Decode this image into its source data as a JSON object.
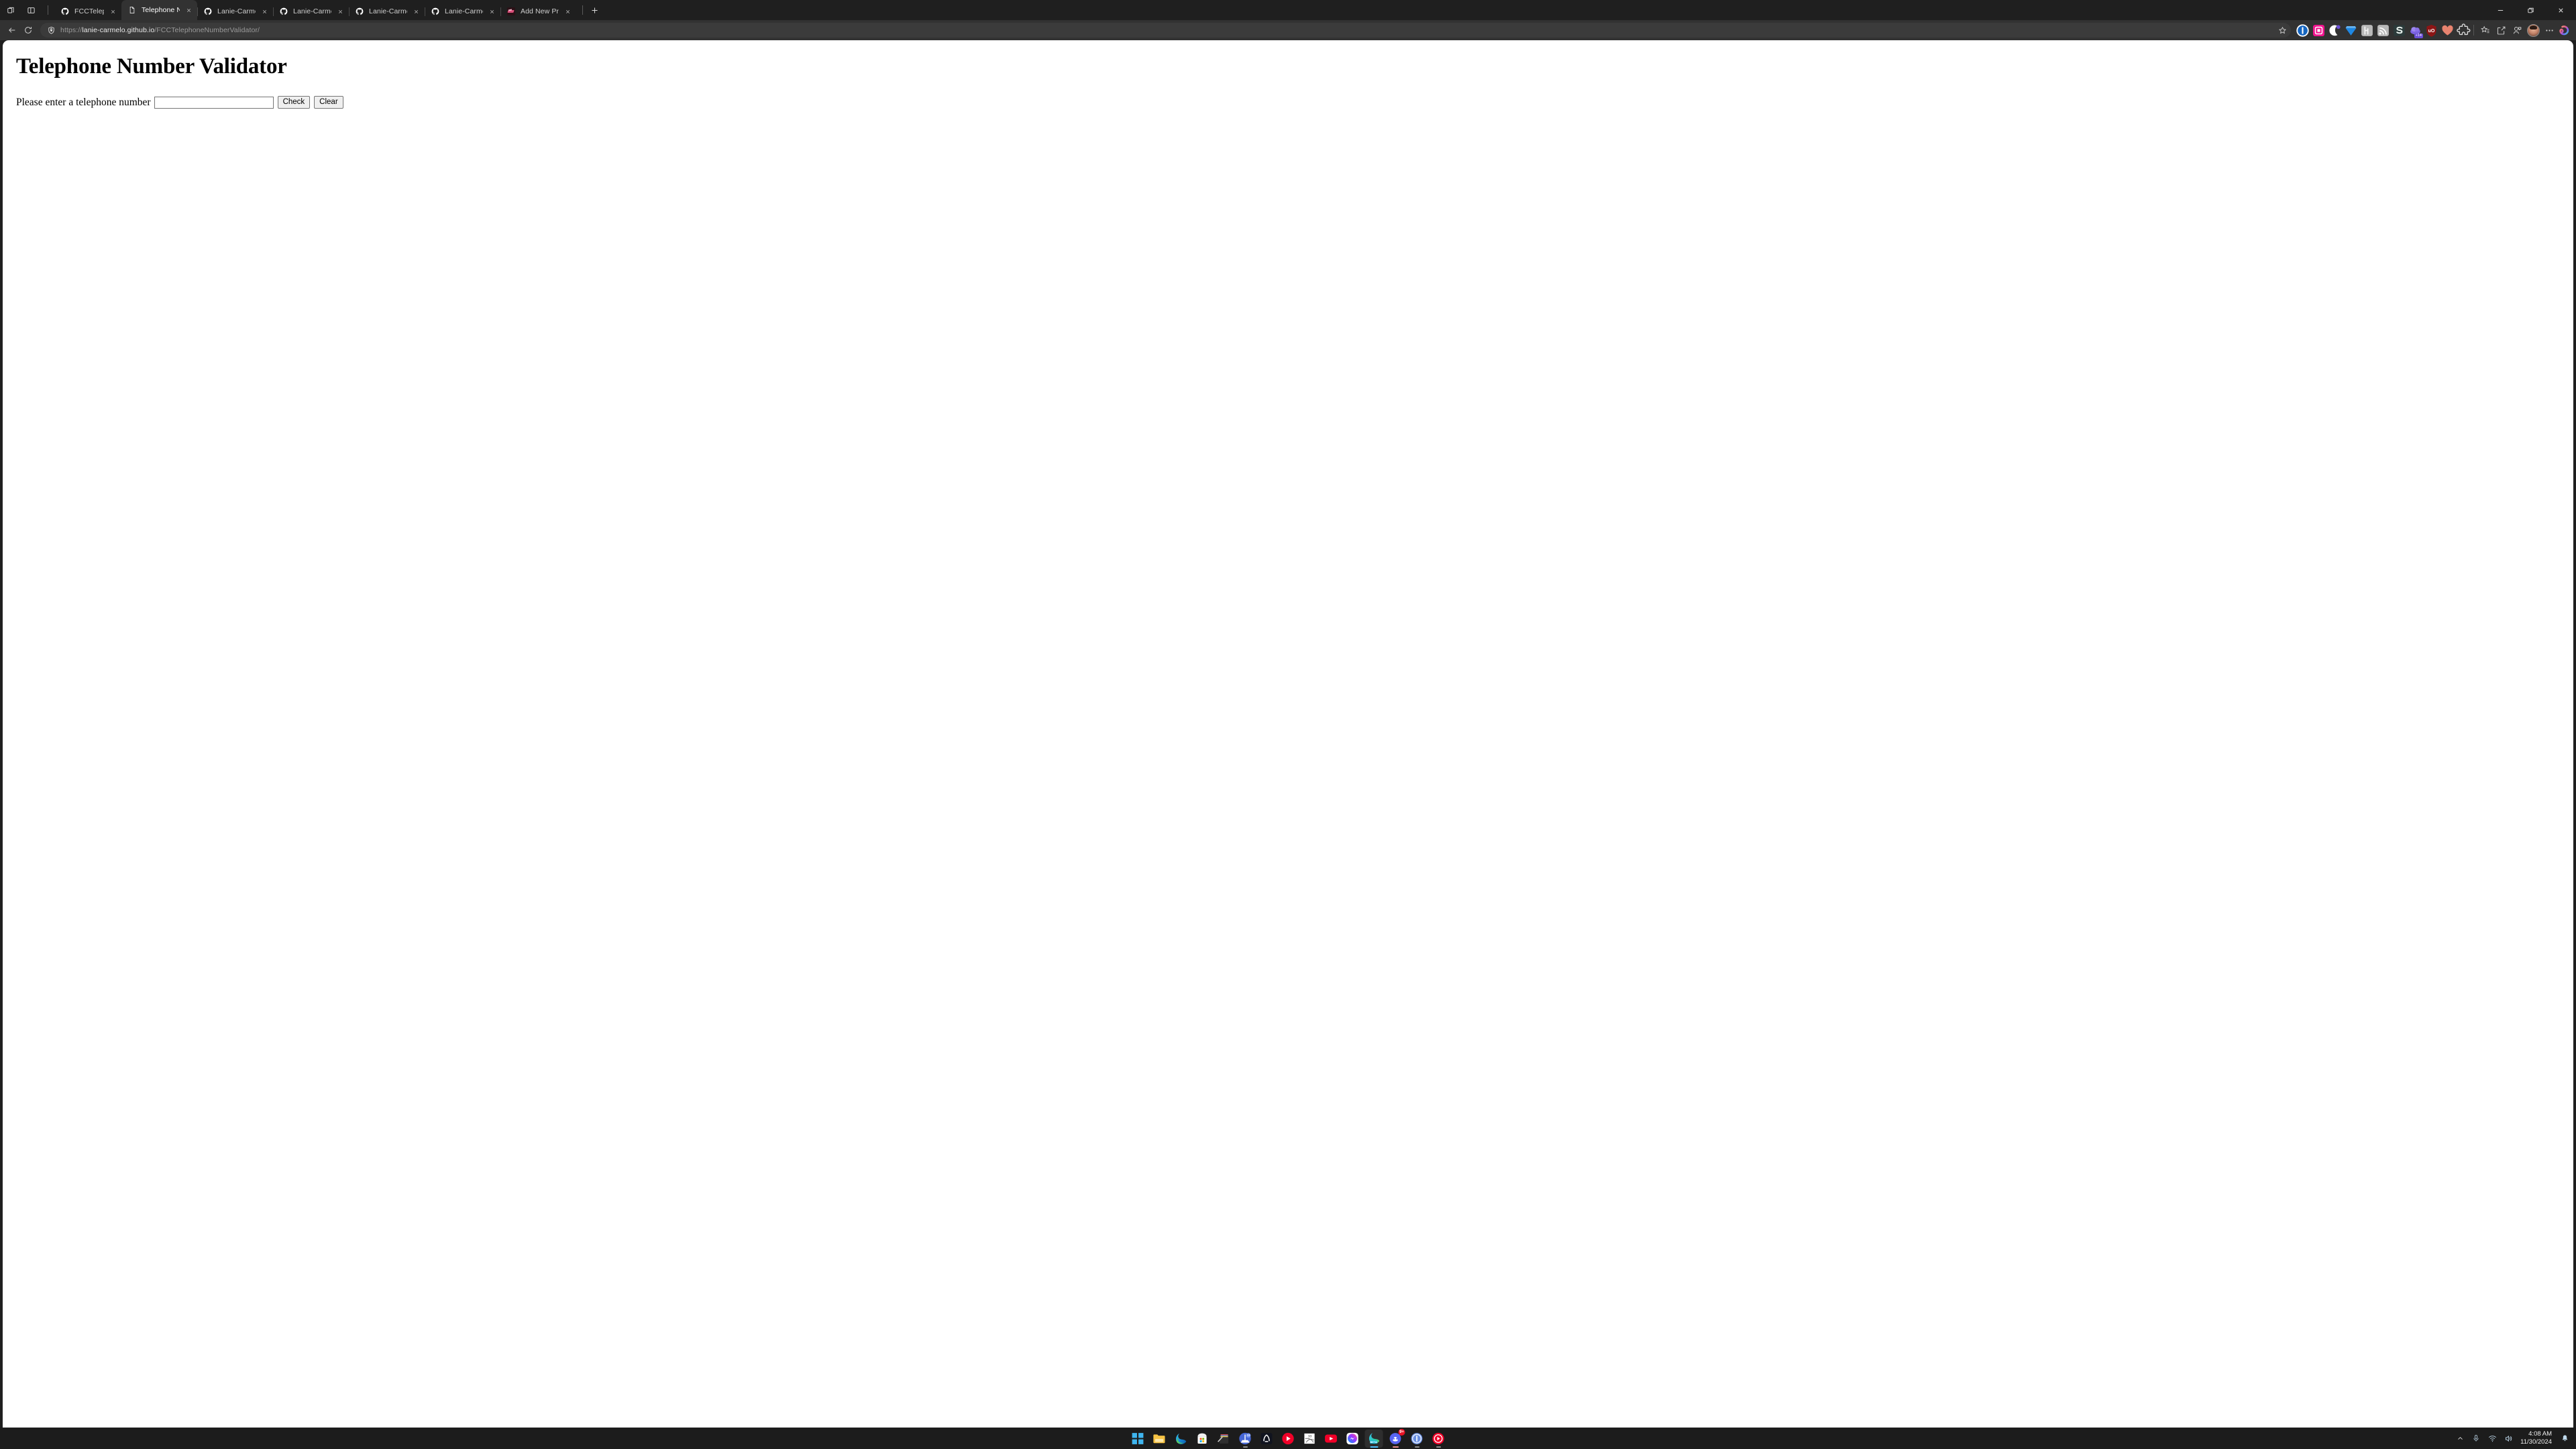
{
  "window": {
    "controls": {
      "minimize_label": "Minimize",
      "maximize_label": "Restore",
      "close_label": "Close"
    }
  },
  "tab_strip": {
    "tab_actions_label": "Tab actions menu",
    "split_screen_label": "Split screen",
    "new_tab_label": "New tab",
    "tabs": [
      {
        "title": "FCCTelephoneNumberValidator/ a",
        "favicon": "github-icon",
        "active": false,
        "width": 100
      },
      {
        "title": "Telephone Number Validator",
        "favicon": "document-icon",
        "active": true,
        "width": 113
      },
      {
        "title": "Lanie-Carmelo/FCCCashRegisterP",
        "favicon": "github-icon",
        "active": false,
        "width": 113
      },
      {
        "title": "Lanie-Carmelo/fCCPokemonSear",
        "favicon": "github-icon",
        "active": false,
        "width": 113
      },
      {
        "title": "Lanie-Carmelo/DasmotosArtsAnd",
        "favicon": "github-icon",
        "active": false,
        "width": 113
      },
      {
        "title": "Lanie-Carmelo/HTML-Cheat-She",
        "favicon": "github-icon",
        "active": false,
        "width": 113
      },
      {
        "title": "Add New Project ‹ Life of a Rare B",
        "favicon": "wordpress-site-icon",
        "active": false,
        "width": 113
      }
    ]
  },
  "toolbar": {
    "back_label": "Back",
    "refresh_label": "Refresh",
    "url_scheme": "https://",
    "url_host": "lanie-carmelo.github.io",
    "url_path": "/FCCTelephoneNumberValidator/",
    "site_info_label": "View site information",
    "favorite_label": "Add this page to favorites",
    "extensions": [
      {
        "name": "1password-extension-icon",
        "color": "#1565c0",
        "letter": "1"
      },
      {
        "name": "pink-box-extension-icon",
        "color": "#f0158f",
        "letter": ""
      },
      {
        "name": "moon-reader-extension-icon",
        "color": "#ffffff",
        "letter": ""
      },
      {
        "name": "gem-extension-icon",
        "color": "#1e88e5",
        "letter": ""
      },
      {
        "name": "honey-extension-icon",
        "color": "#b9b9b9",
        "letter": "h"
      },
      {
        "name": "rss-feed-extension-icon",
        "color": "#b9b9b9",
        "letter": ""
      },
      {
        "name": "stylus-extension-icon",
        "color": "#2b3a3a",
        "letter": "S"
      },
      {
        "name": "purple-cloud-extension-icon",
        "color": "#6a4fd6",
        "letter": "",
        "badge": "+14"
      },
      {
        "name": "ublock-origin-extension-icon",
        "color": "#8c1515",
        "letter": "uO"
      },
      {
        "name": "heart-extension-icon",
        "color": "#e8836f",
        "letter": ""
      },
      {
        "name": "browser-extensions-puzzle-icon",
        "color": "transparent",
        "letter": ""
      }
    ],
    "favorites_label": "Favorites",
    "collections_label": "Collections",
    "browser_essentials_label": "Browser essentials",
    "profile_label": "Profile",
    "settings_label": "Settings and more",
    "copilot_label": "Copilot"
  },
  "page": {
    "title": "Telephone Number Validator",
    "form": {
      "label": "Please enter a telephone number",
      "input_value": "",
      "input_placeholder": "",
      "check_button": "Check",
      "clear_button": "Clear"
    }
  },
  "taskbar": {
    "apps": [
      {
        "name": "start-button-icon",
        "running": false
      },
      {
        "name": "file-explorer-icon",
        "running": false
      },
      {
        "name": "microsoft-edge-icon",
        "running": false
      },
      {
        "name": "microsoft-store-icon",
        "running": false
      },
      {
        "name": "file-archiver-icon",
        "running": false
      },
      {
        "name": "balena-etcher-icon",
        "running": true,
        "badge": ""
      },
      {
        "name": "audacity-icon",
        "running": false
      },
      {
        "name": "youtube-music-icon",
        "running": false
      },
      {
        "name": "calendar-10-icon",
        "running": false
      },
      {
        "name": "youtube-icon",
        "running": false
      },
      {
        "name": "messenger-icon",
        "running": false
      },
      {
        "name": "microsoft-edge-beta-icon",
        "running": true,
        "active": true
      },
      {
        "name": "discord-icon",
        "running": true,
        "badge": "9+"
      },
      {
        "name": "1password-icon",
        "running": true
      },
      {
        "name": "youtube-music-desktop-icon",
        "running": true
      }
    ],
    "tray": {
      "show_hidden_label": "Show hidden icons",
      "microphone_label": "Microphone",
      "network_label": "Network - Internet access",
      "volume_label": "Volume",
      "time": "4:08 AM",
      "date": "11/30/2024",
      "notifications_label": "Notifications"
    }
  },
  "colors": {
    "chrome_bg": "#1f1f1f",
    "toolbar_bg": "#323232",
    "active_tab_bg": "#323232",
    "page_bg": "#ffffff",
    "taskbar_bg": "#1c1c1c",
    "accent": "#4cc2ff"
  }
}
